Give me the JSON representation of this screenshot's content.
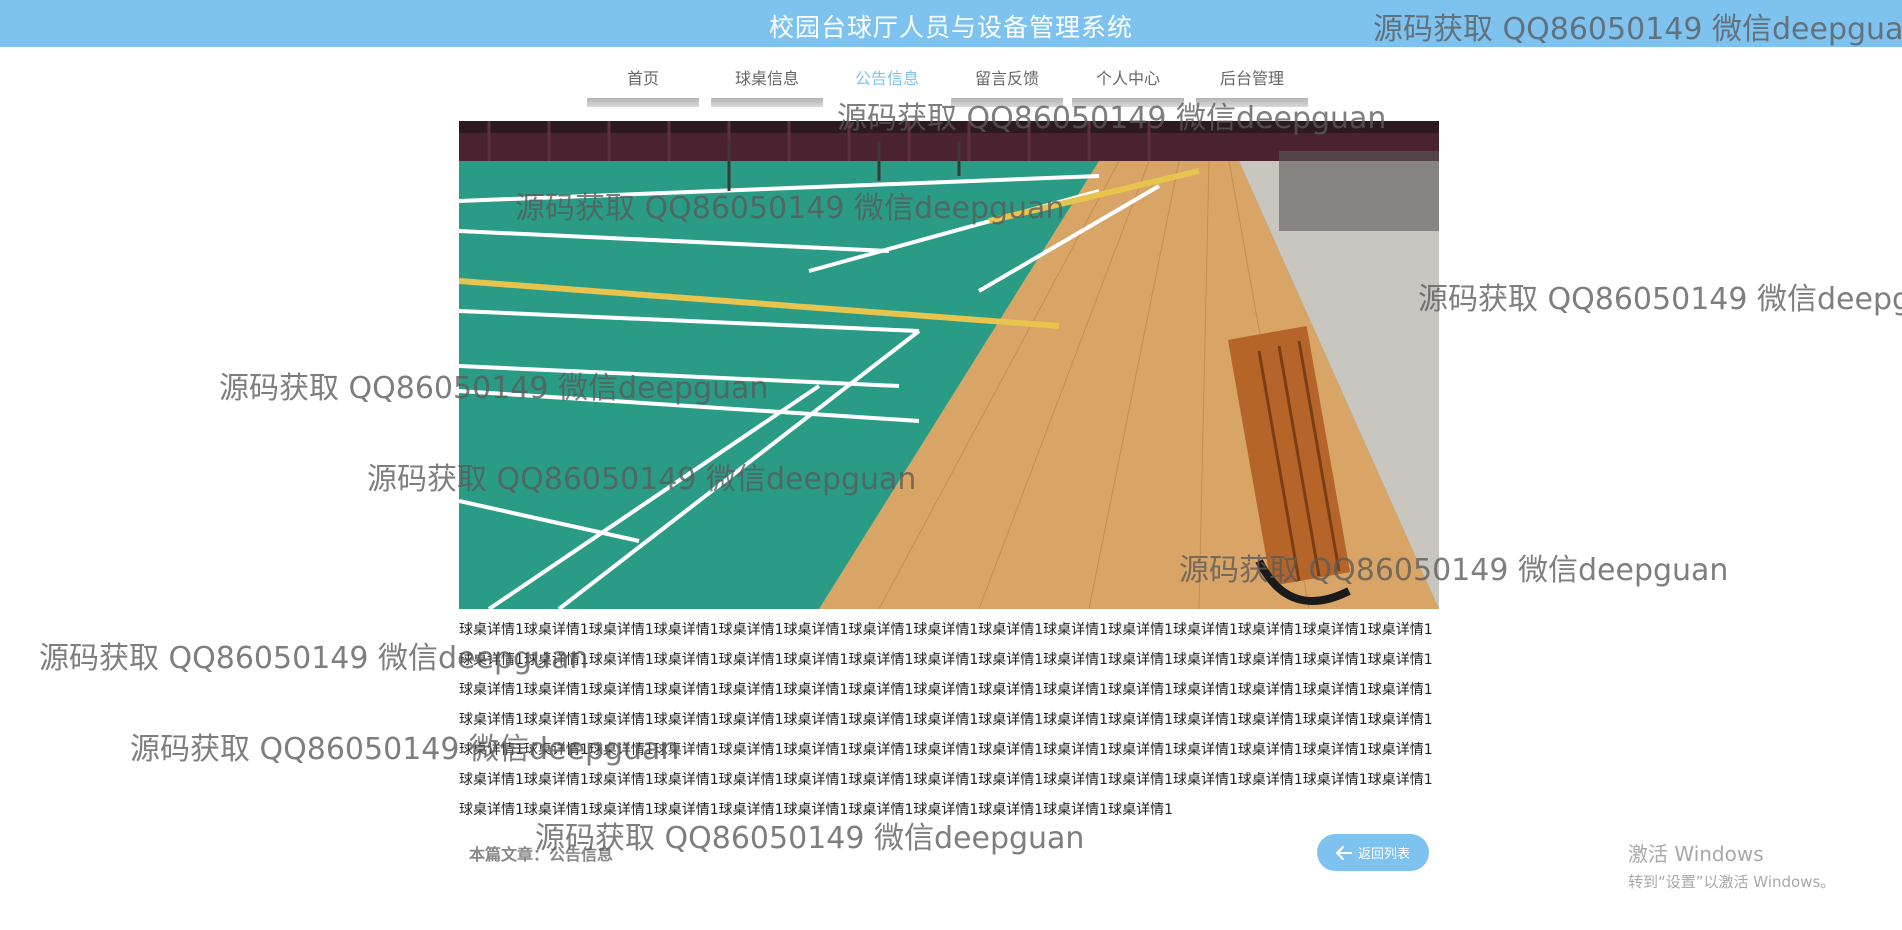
{
  "header": {
    "title": "校园台球厅人员与设备管理系统"
  },
  "nav": {
    "items": [
      {
        "label": "首页"
      },
      {
        "label": "球桌信息"
      },
      {
        "label": "公告信息"
      },
      {
        "label": "留言反馈"
      },
      {
        "label": "个人中心"
      },
      {
        "label": "后台管理"
      }
    ],
    "active_index": 2
  },
  "article": {
    "body": "球桌详情1球桌详情1球桌详情1球桌详情1球桌详情1球桌详情1球桌详情1球桌详情1球桌详情1球桌详情1球桌详情1球桌详情1球桌详情1球桌详情1球桌详情1球桌详情1球桌详情1球桌详情1球桌详情1球桌详情1球桌详情1球桌详情1球桌详情1球桌详情1球桌详情1球桌详情1球桌详情1球桌详情1球桌详情1球桌详情1球桌详情1球桌详情1球桌详情1球桌详情1球桌详情1球桌详情1球桌详情1球桌详情1球桌详情1球桌详情1球桌详情1球桌详情1球桌详情1球桌详情1球桌详情1球桌详情1球桌详情1球桌详情1球桌详情1球桌详情1球桌详情1球桌详情1球桌详情1球桌详情1球桌详情1球桌详情1球桌详情1球桌详情1球桌详情1球桌详情1球桌详情1球桌详情1球桌详情1球桌详情1球桌详情1球桌详情1球桌详情1球桌详情1球桌详情1球桌详情1球桌详情1球桌详情1球桌详情1球桌详情1球桌详情1球桌详情1球桌详情1球桌详情1球桌详情1球桌详情1球桌详情1球桌详情1球桌详情1球桌详情1球桌详情1球桌详情1球桌详情1球桌详情1球桌详情1球桌详情1球桌详情1球桌详情1球桌详情1球桌详情1球桌详情1球桌详情1球桌详情1球桌详情1球桌详情1球桌详情1球桌详情1",
    "meta": "本篇文章：公告信息",
    "back_label": "返回列表",
    "back_icon": "arrow-left-icon"
  },
  "watermark": "源码获取 QQ86050149 微信deepguan",
  "windows_activation": {
    "title": "激活 Windows",
    "subtitle": "转到“设置”以激活 Windows。"
  },
  "colors": {
    "header_bg": "#7ec3ef",
    "accent": "#7ec3ef",
    "court_green": "#2a9c86",
    "wood_floor": "#d9a566"
  }
}
